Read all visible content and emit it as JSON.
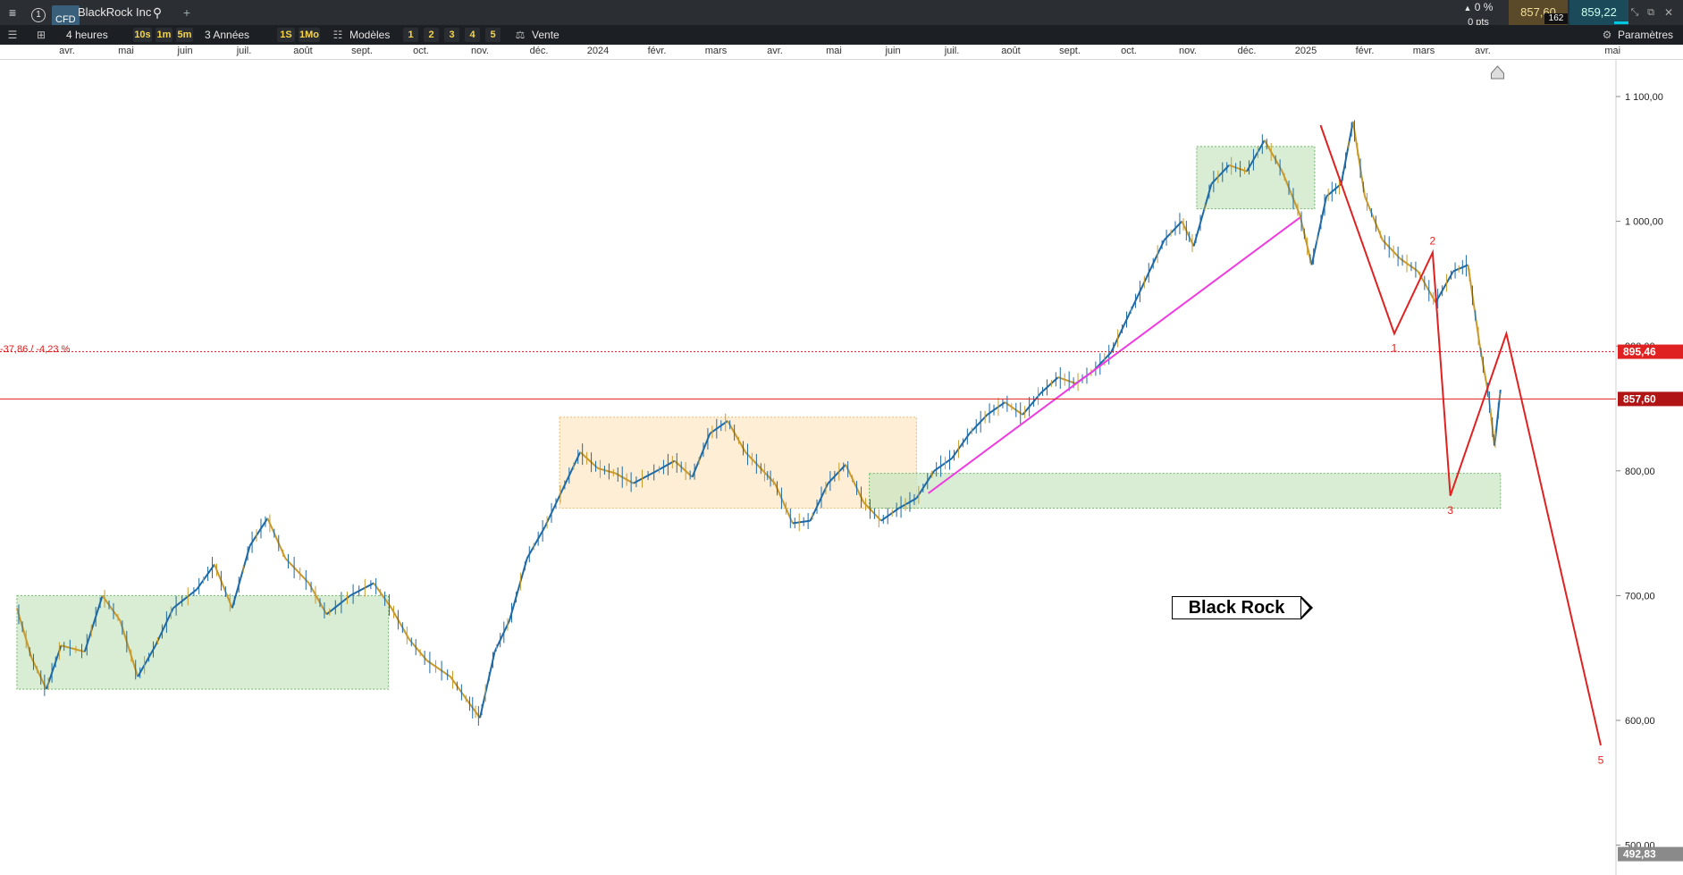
{
  "topbar": {
    "menu_icon": "hamburger-icon",
    "tab_number": "1",
    "badge": "CFD",
    "title": "BlackRock Inc",
    "search_icon": "search-icon",
    "add_icon": "plus-icon",
    "change_pct": "0 %",
    "change_pts": "0 pts",
    "bid": "857,60",
    "spread": "162",
    "ask": "859,22",
    "window_icons": [
      "minimize-icon",
      "shrink-icon",
      "popout-icon",
      "close-icon"
    ]
  },
  "toolbar": {
    "list_icon": "list-icon",
    "layout_icon": "layout-grid-icon",
    "interval": "4 heures",
    "quick_intervals": [
      "10s",
      "1m",
      "5m"
    ],
    "range": "3 Années",
    "period_buttons": [
      "1S",
      "1Mo"
    ],
    "models_label": "Modèles",
    "numbered_buttons": [
      "1",
      "2",
      "3",
      "4",
      "5"
    ],
    "sell_label": "Vente",
    "settings_label": "Paramètres"
  },
  "colors": {
    "accent_red": "#e02121",
    "candle_up": "#1e6aa6",
    "candle_down": "#c99a2b",
    "zone_green": "#c7e5c1",
    "zone_orange": "#fde3b9",
    "magenta": "#ef3ce0",
    "bid_bg": "#5a4a2a",
    "ask_bg": "#1b4a5a"
  },
  "chart_data": {
    "type": "line",
    "instrument": "BlackRock Inc",
    "months": [
      {
        "label": "avr.",
        "t": 0.0
      },
      {
        "label": "mai",
        "t": 1.0
      },
      {
        "label": "juin",
        "t": 2.0
      },
      {
        "label": "juil.",
        "t": 3.0
      },
      {
        "label": "août",
        "t": 4.0
      },
      {
        "label": "sept.",
        "t": 5.0
      },
      {
        "label": "oct.",
        "t": 6.0
      },
      {
        "label": "nov.",
        "t": 7.0
      },
      {
        "label": "déc.",
        "t": 8.0
      },
      {
        "label": "2024",
        "t": 9.0
      },
      {
        "label": "févr.",
        "t": 10.0
      },
      {
        "label": "mars",
        "t": 11.0
      },
      {
        "label": "avr.",
        "t": 12.0
      },
      {
        "label": "mai",
        "t": 13.0
      },
      {
        "label": "juin",
        "t": 14.0
      },
      {
        "label": "juil.",
        "t": 15.0
      },
      {
        "label": "août",
        "t": 16.0
      },
      {
        "label": "sept.",
        "t": 17.0
      },
      {
        "label": "oct.",
        "t": 18.0
      },
      {
        "label": "nov.",
        "t": 19.0
      },
      {
        "label": "déc.",
        "t": 20.0
      },
      {
        "label": "2025",
        "t": 21.0
      },
      {
        "label": "févr.",
        "t": 22.0
      },
      {
        "label": "mars",
        "t": 23.0
      },
      {
        "label": "avr.",
        "t": 24.0
      },
      {
        "label": "mai",
        "t": 26.2
      }
    ],
    "y_ticks": [
      "1 100,00",
      "1 000,00",
      "900,00",
      "800,00",
      "700,00",
      "600,00",
      "500,00"
    ],
    "y_tick_values": [
      1100,
      1000,
      900,
      800,
      700,
      600,
      500
    ],
    "ylim": [
      480,
      1130
    ],
    "xlim": [
      -0.9,
      26.9
    ],
    "price_line": [
      [
        -0.85,
        690
      ],
      [
        -0.6,
        650
      ],
      [
        -0.35,
        625
      ],
      [
        -0.1,
        660
      ],
      [
        0.3,
        655
      ],
      [
        0.6,
        700
      ],
      [
        0.9,
        680
      ],
      [
        1.2,
        635
      ],
      [
        1.5,
        660
      ],
      [
        1.8,
        690
      ],
      [
        2.2,
        705
      ],
      [
        2.5,
        725
      ],
      [
        2.8,
        690
      ],
      [
        3.1,
        740
      ],
      [
        3.4,
        762
      ],
      [
        3.7,
        730
      ],
      [
        4.1,
        710
      ],
      [
        4.4,
        685
      ],
      [
        4.8,
        700
      ],
      [
        5.2,
        710
      ],
      [
        5.5,
        690
      ],
      [
        5.8,
        665
      ],
      [
        6.1,
        648
      ],
      [
        6.5,
        635
      ],
      [
        6.8,
        615
      ],
      [
        7.0,
        602
      ],
      [
        7.25,
        655
      ],
      [
        7.5,
        680
      ],
      [
        7.8,
        730
      ],
      [
        8.1,
        755
      ],
      [
        8.4,
        785
      ],
      [
        8.7,
        815
      ],
      [
        9.0,
        802
      ],
      [
        9.3,
        798
      ],
      [
        9.6,
        790
      ],
      [
        10.0,
        800
      ],
      [
        10.3,
        808
      ],
      [
        10.6,
        795
      ],
      [
        10.9,
        830
      ],
      [
        11.2,
        840
      ],
      [
        11.5,
        815
      ],
      [
        11.8,
        800
      ],
      [
        12.0,
        790
      ],
      [
        12.3,
        758
      ],
      [
        12.6,
        760
      ],
      [
        12.9,
        790
      ],
      [
        13.2,
        805
      ],
      [
        13.5,
        775
      ],
      [
        13.8,
        760
      ],
      [
        14.1,
        770
      ],
      [
        14.4,
        778
      ],
      [
        14.7,
        800
      ],
      [
        15.0,
        810
      ],
      [
        15.3,
        830
      ],
      [
        15.6,
        845
      ],
      [
        15.9,
        855
      ],
      [
        16.2,
        845
      ],
      [
        16.5,
        862
      ],
      [
        16.8,
        875
      ],
      [
        17.1,
        870
      ],
      [
        17.4,
        880
      ],
      [
        17.7,
        895
      ],
      [
        18.0,
        925
      ],
      [
        18.3,
        955
      ],
      [
        18.6,
        985
      ],
      [
        18.9,
        1000
      ],
      [
        19.1,
        980
      ],
      [
        19.4,
        1030
      ],
      [
        19.7,
        1045
      ],
      [
        20.0,
        1040
      ],
      [
        20.3,
        1065
      ],
      [
        20.6,
        1040
      ],
      [
        20.9,
        1005
      ],
      [
        21.1,
        965
      ],
      [
        21.35,
        1020
      ],
      [
        21.6,
        1030
      ],
      [
        21.8,
        1080
      ],
      [
        22.0,
        1020
      ],
      [
        22.3,
        985
      ],
      [
        22.6,
        970
      ],
      [
        22.9,
        960
      ],
      [
        23.2,
        935
      ],
      [
        23.5,
        960
      ],
      [
        23.75,
        965
      ],
      [
        23.95,
        900
      ],
      [
        24.1,
        860
      ],
      [
        24.2,
        820
      ],
      [
        24.3,
        865
      ]
    ],
    "current_price": 857.6,
    "reference_price": 895.46,
    "reference_label": "895,46",
    "current_label": "857,60",
    "lowest_visible_label": "492,83",
    "lowest_visible_value": 492.83,
    "annotation_text": "-37,86 / -4,23 %",
    "zones": [
      {
        "color": "green",
        "t0": -0.85,
        "t1": 5.45,
        "p0": 625,
        "p1": 700
      },
      {
        "color": "orange",
        "t0": 8.35,
        "t1": 14.4,
        "p0": 770,
        "p1": 843
      },
      {
        "color": "green",
        "t0": 13.6,
        "t1": 24.3,
        "p0": 770,
        "p1": 798
      },
      {
        "color": "green",
        "t0": 19.15,
        "t1": 21.15,
        "p0": 1010,
        "p1": 1060
      }
    ],
    "trendline": {
      "color": "magenta",
      "points": [
        [
          14.6,
          782
        ],
        [
          20.9,
          1003
        ]
      ]
    },
    "wave": {
      "color": "red",
      "points": [
        [
          21.25,
          1077
        ],
        [
          22.5,
          910
        ],
        [
          23.15,
          975
        ],
        [
          23.45,
          780
        ],
        [
          24.4,
          910
        ],
        [
          26.0,
          580
        ]
      ],
      "labels": [
        {
          "text": "1",
          "t": 22.5,
          "p": 904,
          "pos": "below"
        },
        {
          "text": "2",
          "t": 23.15,
          "p": 980,
          "pos": "above"
        },
        {
          "text": "3",
          "t": 23.45,
          "p": 774,
          "pos": "below"
        },
        {
          "text": "5",
          "t": 26.0,
          "p": 574,
          "pos": "below"
        }
      ]
    },
    "chart_label": "Black Rock",
    "grid": false,
    "legend": "none"
  }
}
